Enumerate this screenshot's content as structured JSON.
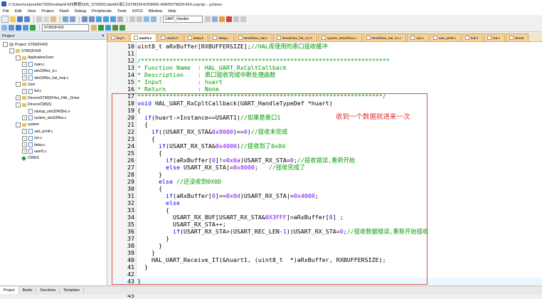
{
  "window": {
    "title": "C:\\Users\\cepreal\\H730\\Desktop\\F429教程\\005_STM32CubeMX串口\\STM32F429\\MDK-ARM\\STM32F429.uvprojx - µVision"
  },
  "menu": [
    "File",
    "Edit",
    "View",
    "Project",
    "Flash",
    "Debug",
    "Peripherals",
    "Tools",
    "SVCS",
    "Window",
    "Help"
  ],
  "toolbar": {
    "function_combo": "UART_Handler",
    "target_combo": "STM32F429"
  },
  "sidebar": {
    "title": "Project",
    "tree": [
      {
        "label": "Project: STM32F429",
        "level": 0,
        "kind": "project",
        "exp": "-"
      },
      {
        "label": "STM32F429",
        "level": 1,
        "kind": "folder",
        "exp": "-"
      },
      {
        "label": "Application/User",
        "level": 2,
        "kind": "folder",
        "exp": "-"
      },
      {
        "label": "main.c",
        "level": 3,
        "kind": "file",
        "exp": "+"
      },
      {
        "label": "stm32f4xx_it.c",
        "level": 3,
        "kind": "file",
        "exp": "+"
      },
      {
        "label": "stm32f4xx_hal_msp.c",
        "level": 3,
        "kind": "file",
        "exp": "+"
      },
      {
        "label": "User",
        "level": 2,
        "kind": "folder",
        "exp": "-"
      },
      {
        "label": "led.c",
        "level": 3,
        "kind": "file",
        "exp": "+"
      },
      {
        "label": "Drivers/STM32F4xx_HAL_Driver",
        "level": 2,
        "kind": "folder",
        "exp": "+"
      },
      {
        "label": "Drivers/CMSIS",
        "level": 2,
        "kind": "folder",
        "exp": "-"
      },
      {
        "label": "startup_stm32f429xx.s",
        "level": 3,
        "kind": "file",
        "exp": ""
      },
      {
        "label": "system_stm32f4xx.c",
        "level": 3,
        "kind": "file",
        "exp": "+"
      },
      {
        "label": "system",
        "level": 2,
        "kind": "folder",
        "exp": "-"
      },
      {
        "label": "uart_printf.c",
        "level": 3,
        "kind": "file",
        "exp": "+"
      },
      {
        "label": "sys.c",
        "level": 3,
        "kind": "file",
        "exp": "+"
      },
      {
        "label": "delay.c",
        "level": 3,
        "kind": "file",
        "exp": "+"
      },
      {
        "label": "usart1.c",
        "level": 3,
        "kind": "file",
        "exp": "+"
      },
      {
        "label": "CMSIS",
        "level": 2,
        "kind": "cmsis",
        "exp": ""
      }
    ]
  },
  "tabs": [
    {
      "label": "key.h",
      "active": false
    },
    {
      "label": "usart1.c",
      "active": true
    },
    {
      "label": "usart1.h",
      "active": false
    },
    {
      "label": "delay.h",
      "active": false
    },
    {
      "label": "delay.c",
      "active": false
    },
    {
      "label": "stm32f4xx_hal.c",
      "active": false
    },
    {
      "label": "stm32f4xx_hal_rcc.h",
      "active": false
    },
    {
      "label": "system_stm32f4xx.c",
      "active": false
    },
    {
      "label": "stm32f4xx_hal_rcc.c",
      "active": false
    },
    {
      "label": "sys.c",
      "active": false
    },
    {
      "label": "uart_printf.c",
      "active": false
    },
    {
      "label": "led.h",
      "active": false
    },
    {
      "label": "led.c",
      "active": false
    },
    {
      "label": "stm32",
      "active": false
    }
  ],
  "code": [
    {
      "ln": "10",
      "parts": [
        [
          "t",
          "uint8_t aRxBuffer[RXBUFFERSIZE];"
        ],
        [
          "g",
          "//HAL库使用的串口接收缓冲"
        ]
      ]
    },
    {
      "ln": "11",
      "parts": []
    },
    {
      "ln": "12",
      "parts": [
        [
          "g",
          "/**********************************************************************"
        ]
      ]
    },
    {
      "ln": "13",
      "parts": [
        [
          "g",
          "* Function Name  : HAL_UART_RxCpltCallback"
        ]
      ]
    },
    {
      "ln": "14",
      "parts": [
        [
          "g",
          "* Description    : 串口接收完成中断处理函数"
        ]
      ]
    },
    {
      "ln": "15",
      "parts": [
        [
          "g",
          "* Input          : huart"
        ]
      ]
    },
    {
      "ln": "16",
      "parts": [
        [
          "g",
          "* Return         : None"
        ]
      ]
    },
    {
      "ln": "17",
      "parts": [
        [
          "g",
          "*********************************************************************/"
        ]
      ]
    },
    {
      "ln": "18",
      "parts": [
        [
          "b",
          "void"
        ],
        [
          "t",
          " HAL_UART_RxCpltCallback(UART_HandleTypeDef *huart)"
        ]
      ]
    },
    {
      "ln": "19",
      "parts": [
        [
          "t",
          "{"
        ]
      ]
    },
    {
      "ln": "20",
      "parts": [
        [
          "t",
          "  "
        ],
        [
          "b",
          "if"
        ],
        [
          "t",
          "(huart->Instance==USART1)"
        ],
        [
          "g",
          "//如果是串口1"
        ]
      ]
    },
    {
      "ln": "21",
      "parts": [
        [
          "t",
          "  {"
        ]
      ]
    },
    {
      "ln": "22",
      "parts": [
        [
          "t",
          "    "
        ],
        [
          "b",
          "if"
        ],
        [
          "t",
          "((USART_RX_STA&"
        ],
        [
          "n",
          "0x8000"
        ],
        [
          "t",
          ")=="
        ],
        [
          "n",
          "0"
        ],
        [
          "t",
          ")"
        ],
        [
          "g",
          "//接收未完成"
        ]
      ]
    },
    {
      "ln": "23",
      "parts": [
        [
          "t",
          "    {"
        ]
      ]
    },
    {
      "ln": "24",
      "parts": [
        [
          "t",
          "      "
        ],
        [
          "b",
          "if"
        ],
        [
          "t",
          "(USART_RX_STA&"
        ],
        [
          "n",
          "0x4000"
        ],
        [
          "t",
          ")"
        ],
        [
          "g",
          "//接收到了0x0d"
        ]
      ]
    },
    {
      "ln": "25",
      "parts": [
        [
          "t",
          "      {"
        ]
      ]
    },
    {
      "ln": "26",
      "parts": [
        [
          "t",
          "        "
        ],
        [
          "b",
          "if"
        ],
        [
          "t",
          "(aRxBuffer["
        ],
        [
          "n",
          "0"
        ],
        [
          "t",
          "]!="
        ],
        [
          "n",
          "0x0a"
        ],
        [
          "t",
          ")USART_RX_STA="
        ],
        [
          "n",
          "0"
        ],
        [
          "t",
          ";"
        ],
        [
          "g",
          "//接收错误,重新开始"
        ]
      ]
    },
    {
      "ln": "27",
      "parts": [
        [
          "t",
          "        "
        ],
        [
          "b",
          "else"
        ],
        [
          "t",
          " USART_RX_STA|="
        ],
        [
          "n",
          "0x8000"
        ],
        [
          "t",
          ";   "
        ],
        [
          "g",
          "//接收完成了"
        ]
      ]
    },
    {
      "ln": "28",
      "parts": [
        [
          "t",
          "      }"
        ]
      ]
    },
    {
      "ln": "29",
      "parts": [
        [
          "t",
          "      "
        ],
        [
          "b",
          "else"
        ],
        [
          "t",
          " "
        ],
        [
          "g",
          "//还没收到0X0D"
        ]
      ]
    },
    {
      "ln": "30",
      "parts": [
        [
          "t",
          "      {"
        ]
      ]
    },
    {
      "ln": "31",
      "parts": [
        [
          "t",
          "        "
        ],
        [
          "b",
          "if"
        ],
        [
          "t",
          "(aRxBuffer["
        ],
        [
          "n",
          "0"
        ],
        [
          "t",
          "]=="
        ],
        [
          "n",
          "0x0d"
        ],
        [
          "t",
          ")USART_RX_STA|="
        ],
        [
          "n",
          "0x4000"
        ],
        [
          "t",
          ";"
        ]
      ]
    },
    {
      "ln": "32",
      "parts": [
        [
          "t",
          "        "
        ],
        [
          "b",
          "else"
        ]
      ]
    },
    {
      "ln": "33",
      "parts": [
        [
          "t",
          "        {"
        ]
      ]
    },
    {
      "ln": "34",
      "parts": [
        [
          "t",
          "          USART_RX_BUF[USART_RX_STA&"
        ],
        [
          "n",
          "0X3FFF"
        ],
        [
          "t",
          "]=aRxBuffer["
        ],
        [
          "n",
          "0"
        ],
        [
          "t",
          "] ;"
        ]
      ]
    },
    {
      "ln": "35",
      "parts": [
        [
          "t",
          "          USART_RX_STA++;"
        ]
      ]
    },
    {
      "ln": "36",
      "parts": [
        [
          "t",
          "          "
        ],
        [
          "b",
          "if"
        ],
        [
          "t",
          "(USART_RX_STA>(USART_REC_LEN-"
        ],
        [
          "n",
          "1"
        ],
        [
          "t",
          "))USART_RX_STA="
        ],
        [
          "n",
          "0"
        ],
        [
          "t",
          ";"
        ],
        [
          "g",
          "//接收数据错误,重新开始接收"
        ]
      ]
    },
    {
      "ln": "37",
      "parts": [
        [
          "t",
          "        }"
        ]
      ]
    },
    {
      "ln": "38",
      "parts": [
        [
          "t",
          "      }"
        ]
      ]
    },
    {
      "ln": "39",
      "parts": [
        [
          "t",
          "    }"
        ]
      ]
    },
    {
      "ln": "40",
      "parts": [
        [
          "t",
          "    HAL_UART_Receive_IT(&huart1, (uint8_t  *)aRxBuffer, RXBUFFERSIZE);"
        ]
      ]
    },
    {
      "ln": "41",
      "parts": [
        [
          "t",
          "  }"
        ]
      ]
    },
    {
      "ln": "42",
      "parts": []
    },
    {
      "ln": "43",
      "parts": [
        [
          "t",
          "}"
        ]
      ]
    },
    {
      "ln": "44",
      "parts": []
    },
    {
      "ln": "45",
      "parts": []
    }
  ],
  "annotation": "收到一个数据就进来一次",
  "bottom_tabs": [
    "Project",
    "Books",
    "Functions",
    "Templates"
  ]
}
